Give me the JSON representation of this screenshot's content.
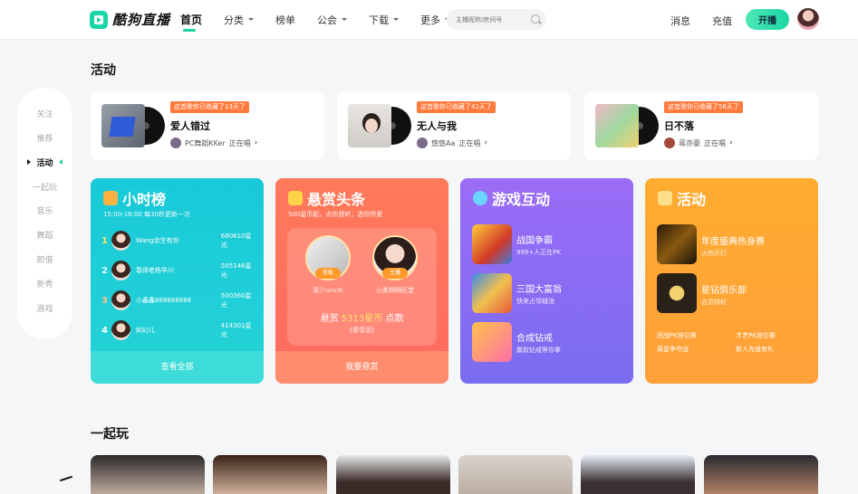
{
  "header": {
    "logo_text": "酷狗直播",
    "nav": [
      {
        "label": "首页",
        "active": true,
        "caret": false
      },
      {
        "label": "分类",
        "active": false,
        "caret": true
      },
      {
        "label": "榜单",
        "active": false,
        "caret": false
      },
      {
        "label": "公会",
        "active": false,
        "caret": true
      },
      {
        "label": "下载",
        "active": false,
        "caret": true
      },
      {
        "label": "更多",
        "active": false,
        "caret": true
      }
    ],
    "search_placeholder": "主播昵称/房间号",
    "messages": "消息",
    "recharge": "充值",
    "start_live": "开播"
  },
  "sidebar": {
    "items": [
      {
        "label": "关注",
        "active": false
      },
      {
        "label": "推荐",
        "active": false
      },
      {
        "label": "活动",
        "active": true
      },
      {
        "label": "一起玩",
        "active": false
      },
      {
        "label": "音乐",
        "active": false
      },
      {
        "label": "舞蹈",
        "active": false
      },
      {
        "label": "颜值",
        "active": false
      },
      {
        "label": "新秀",
        "active": false
      },
      {
        "label": "游戏",
        "active": false
      }
    ]
  },
  "activity": {
    "title": "活动",
    "cards": [
      {
        "badge": "这首歌你已收藏了13天了",
        "song": "爱人错过",
        "singer": "PC舞蹈KKer",
        "status": "正在唱"
      },
      {
        "badge": "这首歌你已收藏了41天了",
        "song": "无人与我",
        "singer": "悠悠Aa",
        "status": "正在唱"
      },
      {
        "badge": "这首歌你已收藏了56天了",
        "song": "日不落",
        "singer": "蒋亦豪",
        "status": "正在唱"
      }
    ]
  },
  "hourly": {
    "title": "小时榜",
    "subtitle": "15:00-16:00 每30秒更新一次",
    "rows": [
      {
        "rank": "1",
        "name": "Wang余生有你",
        "score": "680610星光"
      },
      {
        "rank": "2",
        "name": "尊师老杨早川",
        "score": "505146星光"
      },
      {
        "rank": "3",
        "name": "小鑫鑫888888888",
        "score": "500360星光"
      },
      {
        "rank": "4",
        "name": "如幻儿",
        "score": "414301星光"
      }
    ],
    "footer": "查看全部"
  },
  "bounty": {
    "title": "悬赏头条",
    "subtitle": "500星币起，点你想听，选你所爱",
    "boss_tag": "老板",
    "boss_name": "菜少uncle",
    "host_tag": "主播",
    "host_name": "小柔啊啊旺堂",
    "amount_prefix": "悬赏",
    "amount_value": "5313星币",
    "amount_suffix": "点歌",
    "song": "《春雪泥》",
    "footer": "我要悬赏"
  },
  "games": {
    "title": "游戏互动",
    "items": [
      {
        "name": "战国争霸",
        "sub": "999+人正在PK"
      },
      {
        "name": "三国大富翁",
        "sub": "快来占领城池"
      },
      {
        "name": "合成钻戒",
        "sub": "赢取钻戒等你拿"
      }
    ]
  },
  "events": {
    "title": "活动",
    "items": [
      {
        "name": "年度盛典热身赛",
        "sub": "火热开打"
      },
      {
        "name": "星钻俱乐部",
        "sub": "会员特权"
      }
    ],
    "links": [
      "团战PK排位赛",
      "才艺PK排位赛",
      "周星争夺战",
      "新人充值有礼"
    ]
  },
  "play_together": {
    "title": "一起玩"
  }
}
